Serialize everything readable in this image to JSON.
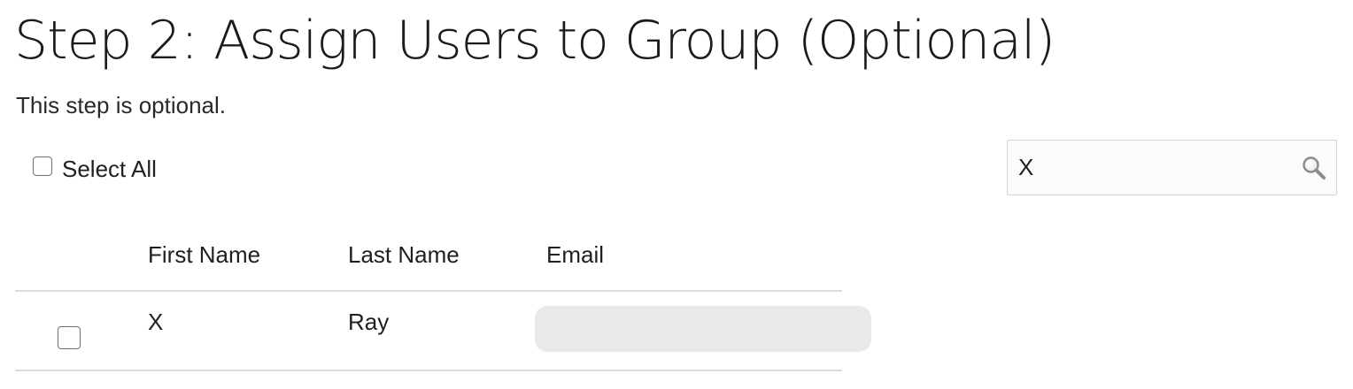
{
  "page": {
    "title": "Step 2: Assign Users to Group (Optional)",
    "description": "This step is optional."
  },
  "toolbar": {
    "select_all_label": "Select All",
    "select_all_checked": false,
    "search_value": "X",
    "search_icon": "search-icon"
  },
  "table": {
    "columns": [
      "First Name",
      "Last Name",
      "Email"
    ],
    "rows": [
      {
        "selected": false,
        "first_name": "X",
        "last_name": "Ray",
        "email": ""
      }
    ]
  },
  "colors": {
    "border": "#dcdcdc",
    "redaction": "#e9e9e9",
    "text": "#1f1f1f"
  }
}
